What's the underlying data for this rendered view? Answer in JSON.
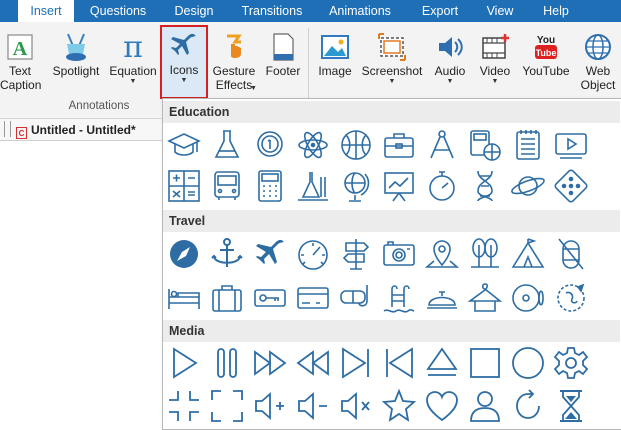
{
  "menubar": {
    "tabs": [
      "Insert",
      "Questions",
      "Design",
      "Transitions",
      "Animations",
      "Export",
      "View",
      "Help"
    ],
    "active_tab": "Insert"
  },
  "ribbon": {
    "buttons": {
      "text_caption": "Text\nCaption",
      "spotlight": "Spotlight",
      "equation": "Equation",
      "icons": "Icons",
      "gesture_effects": "Gesture\nEffects",
      "footer": "Footer",
      "image": "Image",
      "screenshot": "Screenshot",
      "audio": "Audio",
      "video": "Video",
      "youtube": "YouTube",
      "web_object": "Web\nObject"
    },
    "group_label": "Annotations"
  },
  "document": {
    "tab_title": "Untitled - Untitled*"
  },
  "icons_dropdown": {
    "sections": [
      {
        "title": "Education"
      },
      {
        "title": "Travel"
      },
      {
        "title": "Media"
      }
    ],
    "icon_color": "#2e6da4"
  },
  "colors": {
    "menubar": "#1e6fb5",
    "selection_border": "#d62020",
    "accent_icon": "#2e6da4"
  }
}
